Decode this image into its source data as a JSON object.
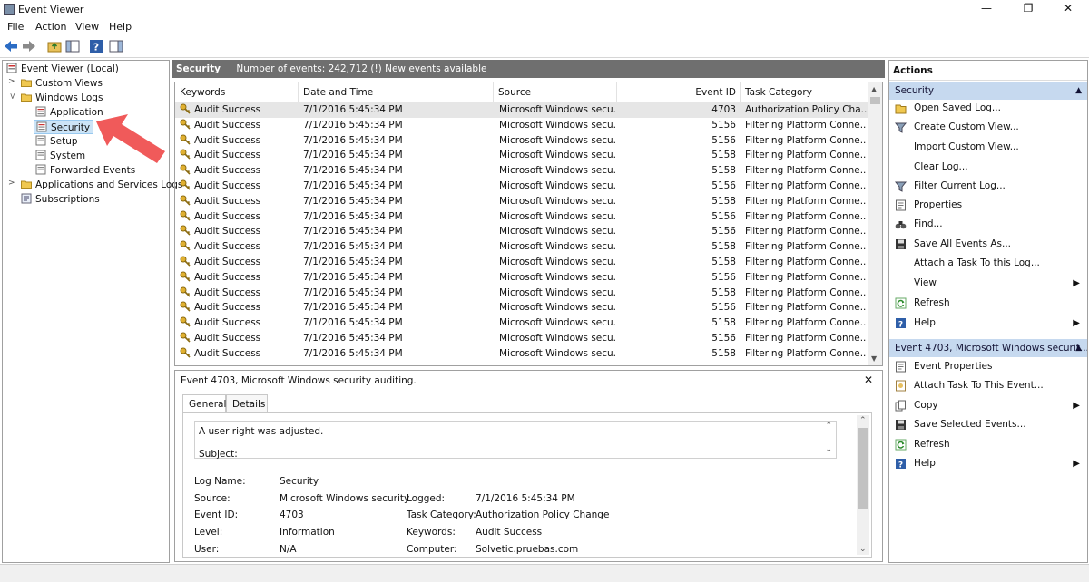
{
  "window": {
    "title": "Event Viewer",
    "minimize": "—",
    "restore": "❐",
    "close": "✕"
  },
  "menu": [
    "File",
    "Action",
    "View",
    "Help"
  ],
  "tree": {
    "root": "Event Viewer (Local)",
    "custom_views": "Custom Views",
    "windows_logs": "Windows Logs",
    "logs": [
      "Application",
      "Security",
      "Setup",
      "System",
      "Forwarded Events"
    ],
    "app_services": "Applications and Services Logs",
    "subscriptions": "Subscriptions"
  },
  "center": {
    "section": "Security",
    "count_text": "Number of events: 242,712 (!) New events available"
  },
  "grid": {
    "columns": [
      "Keywords",
      "Date and Time",
      "Source",
      "Event ID",
      "Task Category"
    ],
    "rows": [
      [
        "Audit Success",
        "7/1/2016 5:45:34 PM",
        "Microsoft Windows secu...",
        "4703",
        "Authorization Policy Cha..."
      ],
      [
        "Audit Success",
        "7/1/2016 5:45:34 PM",
        "Microsoft Windows secu...",
        "5156",
        "Filtering Platform Conne..."
      ],
      [
        "Audit Success",
        "7/1/2016 5:45:34 PM",
        "Microsoft Windows secu...",
        "5156",
        "Filtering Platform Conne..."
      ],
      [
        "Audit Success",
        "7/1/2016 5:45:34 PM",
        "Microsoft Windows secu...",
        "5158",
        "Filtering Platform Conne..."
      ],
      [
        "Audit Success",
        "7/1/2016 5:45:34 PM",
        "Microsoft Windows secu...",
        "5158",
        "Filtering Platform Conne..."
      ],
      [
        "Audit Success",
        "7/1/2016 5:45:34 PM",
        "Microsoft Windows secu...",
        "5156",
        "Filtering Platform Conne..."
      ],
      [
        "Audit Success",
        "7/1/2016 5:45:34 PM",
        "Microsoft Windows secu...",
        "5158",
        "Filtering Platform Conne..."
      ],
      [
        "Audit Success",
        "7/1/2016 5:45:34 PM",
        "Microsoft Windows secu...",
        "5156",
        "Filtering Platform Conne..."
      ],
      [
        "Audit Success",
        "7/1/2016 5:45:34 PM",
        "Microsoft Windows secu...",
        "5156",
        "Filtering Platform Conne..."
      ],
      [
        "Audit Success",
        "7/1/2016 5:45:34 PM",
        "Microsoft Windows secu...",
        "5158",
        "Filtering Platform Conne..."
      ],
      [
        "Audit Success",
        "7/1/2016 5:45:34 PM",
        "Microsoft Windows secu...",
        "5158",
        "Filtering Platform Conne..."
      ],
      [
        "Audit Success",
        "7/1/2016 5:45:34 PM",
        "Microsoft Windows secu...",
        "5156",
        "Filtering Platform Conne..."
      ],
      [
        "Audit Success",
        "7/1/2016 5:45:34 PM",
        "Microsoft Windows secu...",
        "5158",
        "Filtering Platform Conne..."
      ],
      [
        "Audit Success",
        "7/1/2016 5:45:34 PM",
        "Microsoft Windows secu...",
        "5156",
        "Filtering Platform Conne..."
      ],
      [
        "Audit Success",
        "7/1/2016 5:45:34 PM",
        "Microsoft Windows secu...",
        "5158",
        "Filtering Platform Conne..."
      ],
      [
        "Audit Success",
        "7/1/2016 5:45:34 PM",
        "Microsoft Windows secu...",
        "5156",
        "Filtering Platform Conne..."
      ],
      [
        "Audit Success",
        "7/1/2016 5:45:34 PM",
        "Microsoft Windows secu...",
        "5158",
        "Filtering Platform Conne..."
      ]
    ]
  },
  "detail": {
    "title": "Event 4703, Microsoft Windows security auditing.",
    "close": "✕",
    "tabs": [
      "General",
      "Details"
    ],
    "message": "A user right was adjusted.",
    "message_line2": "Subject:",
    "fields": {
      "log_name_label": "Log Name:",
      "log_name": "Security",
      "source_label": "Source:",
      "source": "Microsoft Windows security",
      "logged_label": "Logged:",
      "logged": "7/1/2016 5:45:34 PM",
      "event_id_label": "Event ID:",
      "event_id": "4703",
      "task_label": "Task Category:",
      "task": "Authorization Policy Change",
      "level_label": "Level:",
      "level": "Information",
      "keywords_label": "Keywords:",
      "keywords": "Audit Success",
      "user_label": "User:",
      "user": "N/A",
      "computer_label": "Computer:",
      "computer": "Solvetic.pruebas.com"
    }
  },
  "actions": {
    "header": "Actions",
    "group1": "Security",
    "items1": [
      "Open Saved Log...",
      "Create Custom View...",
      "Import Custom View...",
      "Clear Log...",
      "Filter Current Log...",
      "Properties",
      "Find...",
      "Save All Events As...",
      "Attach a Task To this Log...",
      "View",
      "Refresh",
      "Help"
    ],
    "group2": "Event 4703, Microsoft Windows securit...",
    "items2": [
      "Event Properties",
      "Attach Task To This Event...",
      "Copy",
      "Save Selected Events...",
      "Refresh",
      "Help"
    ]
  },
  "colors": {
    "accent_arrow": "#f05a5a",
    "group_header": "#c6d9ef",
    "section_bar": "#6f6f6f"
  }
}
